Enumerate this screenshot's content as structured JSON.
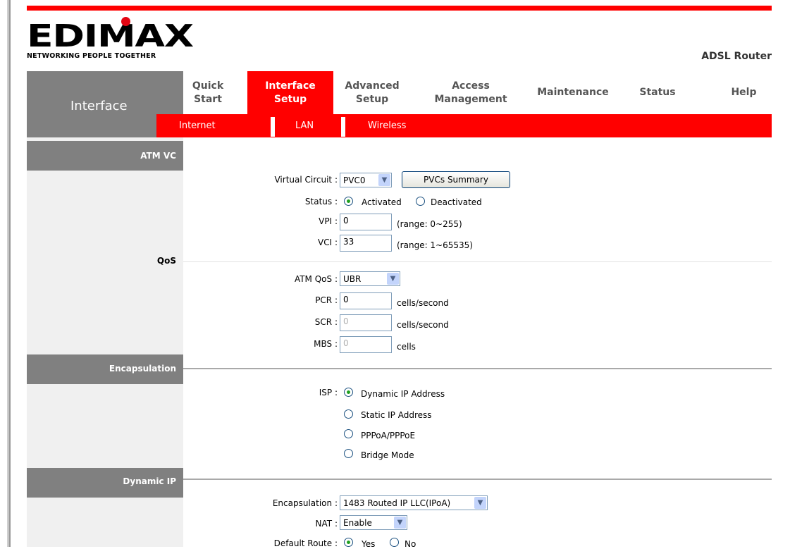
{
  "brand": {
    "logo_text": "EDIMAX",
    "tagline": "NETWORKING PEOPLE TOGETHER",
    "product": "ADSL Router",
    "accent": "#ff0000",
    "logo_dot": "#e30613"
  },
  "nav": {
    "section_label": "Interface",
    "items": [
      {
        "line1": "Quick",
        "line2": "Start"
      },
      {
        "line1": "Interface",
        "line2": "Setup",
        "active": true
      },
      {
        "line1": "Advanced",
        "line2": "Setup"
      },
      {
        "line1": "Access",
        "line2": "Management"
      },
      {
        "line1": "Maintenance",
        "line2": ""
      },
      {
        "line1": "Status",
        "line2": ""
      },
      {
        "line1": "Help",
        "line2": ""
      }
    ],
    "subnav": [
      "Internet",
      "LAN",
      "Wireless"
    ]
  },
  "sections": {
    "atm_vc": "ATM VC",
    "qos": "QoS",
    "encapsulation": "Encapsulation",
    "dynamic_ip": "Dynamic IP"
  },
  "atm": {
    "virtual_circuit_label": "Virtual Circuit :",
    "virtual_circuit_value": "PVC0",
    "pvcs_summary_button": "PVCs Summary",
    "status_label": "Status :",
    "status_activated": "Activated",
    "status_deactivated": "Deactivated",
    "status_selected": "Activated",
    "vpi_label": "VPI :",
    "vpi_value": "0",
    "vpi_range": "(range: 0~255)",
    "vci_label": "VCI :",
    "vci_value": "33",
    "vci_range": "(range: 1~65535)"
  },
  "qos": {
    "atm_qos_label": "ATM QoS :",
    "atm_qos_value": "UBR",
    "pcr_label": "PCR :",
    "pcr_value": "0",
    "pcr_unit": "cells/second",
    "scr_label": "SCR :",
    "scr_value": "0",
    "scr_unit": "cells/second",
    "mbs_label": "MBS :",
    "mbs_value": "0",
    "mbs_unit": "cells"
  },
  "encap": {
    "isp_label": "ISP :",
    "options": [
      "Dynamic IP Address",
      "Static IP Address",
      "PPPoA/PPPoE",
      "Bridge Mode"
    ],
    "selected": "Dynamic IP Address"
  },
  "dynamic": {
    "encapsulation_label": "Encapsulation :",
    "encapsulation_value": "1483 Routed IP LLC(IPoA)",
    "nat_label": "NAT :",
    "nat_value": "Enable",
    "default_route_label": "Default Route :",
    "default_route_yes": "Yes",
    "default_route_no": "No",
    "default_route_selected": "Yes"
  }
}
